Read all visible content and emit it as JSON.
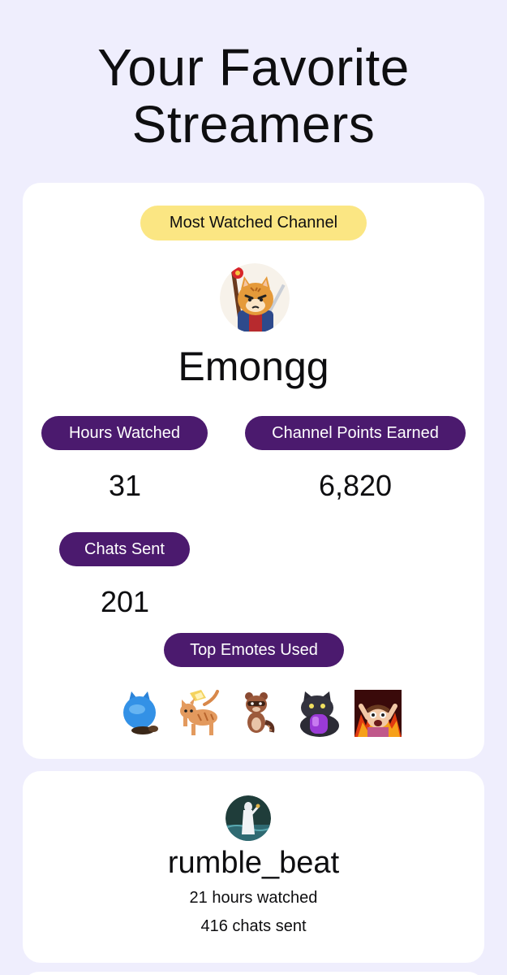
{
  "page": {
    "title_line1": "Your Favorite",
    "title_line2": "Streamers"
  },
  "top_channel": {
    "badge": "Most Watched Channel",
    "avatar_icon": "cat-warrior-avatar-icon",
    "name": "Emongg",
    "stats": {
      "hours_label": "Hours Watched",
      "hours_value": "31",
      "points_label": "Channel Points Earned",
      "points_value": "6,820",
      "chats_label": "Chats Sent",
      "chats_value": "201"
    },
    "emotes_label": "Top Emotes Used",
    "emotes": [
      "blue-cat-emote-icon",
      "orange-cat-emote-icon",
      "raccoon-emote-icon",
      "black-cat-emote-icon",
      "cheering-emote-icon"
    ]
  },
  "second_channel": {
    "avatar_icon": "ghost-figure-avatar-icon",
    "name": "rumble_beat",
    "hours_text": "21 hours watched",
    "chats_text": "416 chats sent"
  },
  "colors": {
    "background": "#efeefd",
    "card": "#ffffff",
    "badge_yellow": "#fbe683",
    "pill_purple": "#4b1a6e"
  }
}
